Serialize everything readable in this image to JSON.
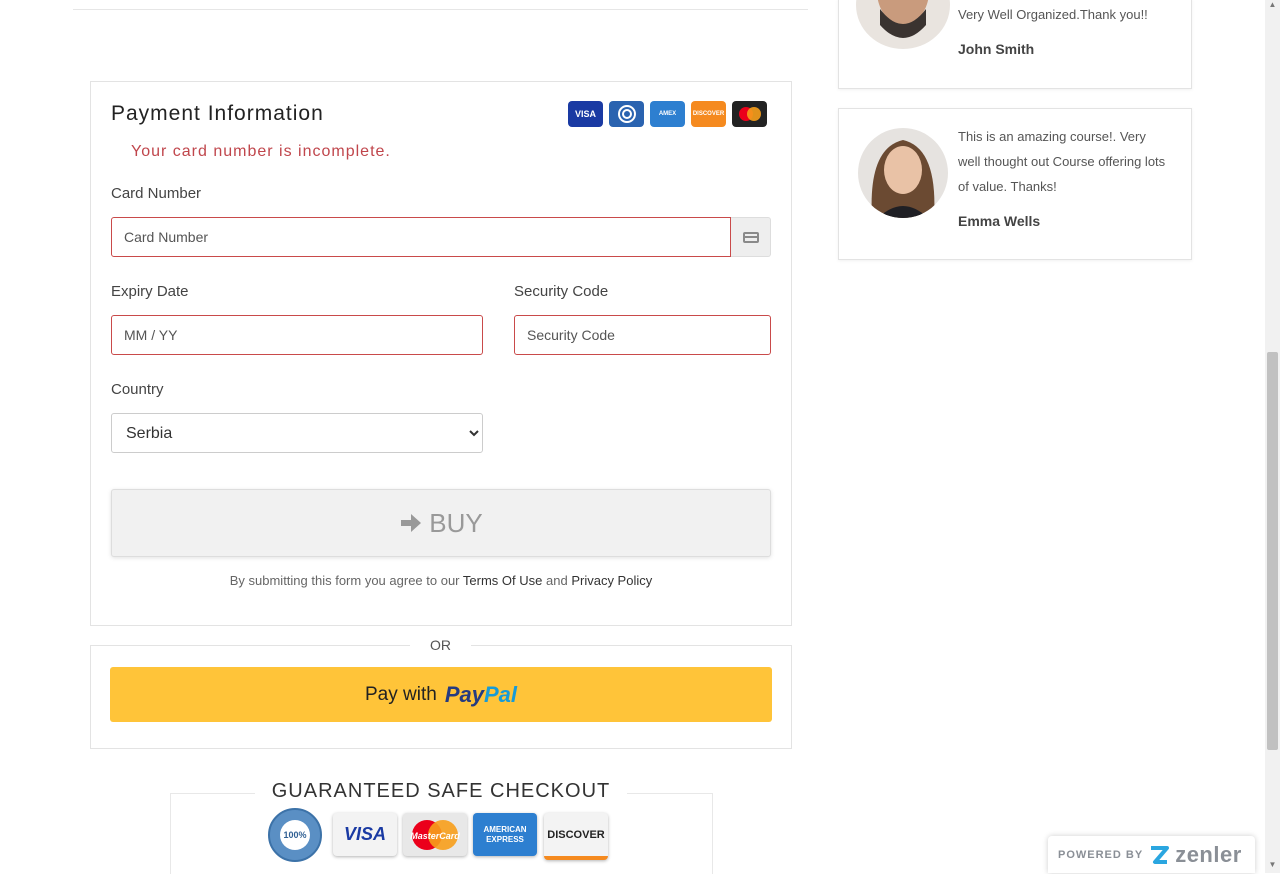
{
  "payment": {
    "title": "Payment Information",
    "error": "Your card number is incomplete.",
    "card_logos": [
      "VISA",
      "Diners",
      "AMEX",
      "DISCOVER",
      "MC"
    ],
    "card_number_label": "Card Number",
    "card_number_placeholder": "Card Number",
    "expiry_label": "Expiry Date",
    "expiry_placeholder": "MM / YY",
    "security_label": "Security Code",
    "security_placeholder": "Security Code",
    "country_label": "Country",
    "country_value": "Serbia",
    "buy_label": "BUY",
    "terms_prefix": "By submitting this form you agree to our",
    "terms_link": "Terms Of Use",
    "terms_and": "and",
    "privacy_link": "Privacy Policy"
  },
  "or_label": "OR",
  "paypal": {
    "pay_with": "Pay with",
    "brand_a": "Pay",
    "brand_b": "Pal"
  },
  "guarantee": {
    "title": "GUARANTEED SAFE CHECKOUT",
    "seal": "100%",
    "cards": [
      "VISA",
      "MasterCard",
      "AMERICAN EXPRESS",
      "DISCOVER"
    ]
  },
  "testimonials": [
    {
      "text": "Very Well Organized.Thank you!!",
      "name": "John Smith"
    },
    {
      "text": "This is an amazing course!. Very well thought out Course offering lots of value. Thanks!",
      "name": "Emma Wells"
    }
  ],
  "powered": {
    "prefix": "POWERED BY",
    "brand": "zenler"
  },
  "colors": {
    "error": "#c0464c",
    "paypal_bg": "#ffc439",
    "paypal_dark": "#253b80",
    "paypal_light": "#179bd7"
  }
}
